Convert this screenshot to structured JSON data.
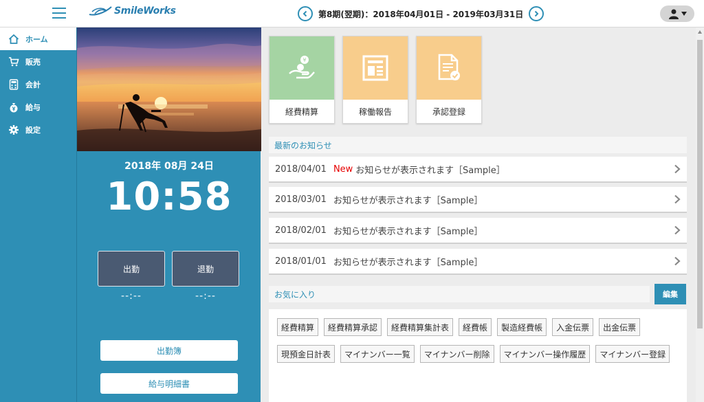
{
  "app": {
    "logo_text": "SmileWorks"
  },
  "header": {
    "period": "第8期(翌期)：2018年04月01日 - 2019年03月31日"
  },
  "sidebar": {
    "items": [
      {
        "label": "ホーム",
        "icon": "home-icon",
        "active": true
      },
      {
        "label": "販売",
        "icon": "cart-icon"
      },
      {
        "label": "会計",
        "icon": "calculator-icon"
      },
      {
        "label": "給与",
        "icon": "yen-bag-icon"
      },
      {
        "label": "設定",
        "icon": "gear-icon"
      }
    ]
  },
  "attendance": {
    "date": "2018年 08月 24日",
    "time": "10:58",
    "clock_in_label": "出勤",
    "clock_out_label": "退勤",
    "clock_in_time": "--:--",
    "clock_out_time": "--:--",
    "attendance_book_label": "出勤簿",
    "payslip_label": "給与明細書"
  },
  "tiles": [
    {
      "label": "経費精算",
      "color": "#a5d4a3",
      "icon": "hand-coin-icon"
    },
    {
      "label": "稼働報告",
      "color": "#f8cd8c",
      "icon": "report-icon"
    },
    {
      "label": "承認登録",
      "color": "#f8cd8c",
      "icon": "document-check-icon"
    }
  ],
  "news": {
    "title": "最新のお知らせ",
    "items": [
      {
        "date": "2018/04/01",
        "new_label": "New",
        "text": "お知らせが表示されます［Sample］"
      },
      {
        "date": "2018/03/01",
        "text": "お知らせが表示されます［Sample］"
      },
      {
        "date": "2018/02/01",
        "text": "お知らせが表示されます［Sample］"
      },
      {
        "date": "2018/01/01",
        "text": "お知らせが表示されます［Sample］"
      }
    ]
  },
  "favorites": {
    "title": "お気に入り",
    "edit_label": "編集",
    "row1": [
      "経費精算",
      "経費精算承認",
      "経費精算集計表",
      "経費帳",
      "製造経費帳",
      "入金伝票",
      "出金伝票"
    ],
    "row2": [
      "現預金日計表",
      "マイナンバー一覧",
      "マイナンバー削除",
      "マイナンバー操作履歴",
      "マイナンバー登録"
    ]
  },
  "colors": {
    "primary": "#2e8fb5",
    "new_badge": "#e60000",
    "punch_button": "#4a5a72"
  }
}
